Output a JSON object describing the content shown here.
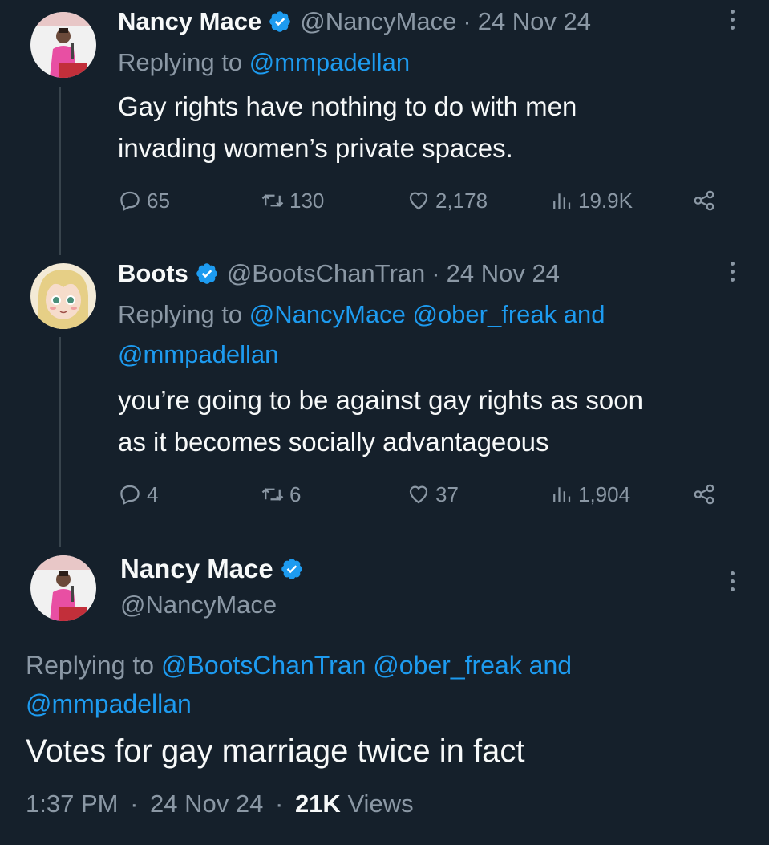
{
  "tweets": [
    {
      "name": "Nancy Mace",
      "handle": "@NancyMace",
      "date": "24 Nov 24",
      "replying_prefix": "Replying to ",
      "replying_line1": "@mmpadellan",
      "replying_line2": "",
      "text_line1": "Gay rights have nothing to do with men",
      "text_line2": "invading women’s private spaces.",
      "replies": "65",
      "retweets": "130",
      "likes": "2,178",
      "views": "19.9K"
    },
    {
      "name": "Boots",
      "handle": "@BootsChanTran",
      "date": "24 Nov 24",
      "replying_prefix": "Replying to ",
      "replying_line1": "@NancyMace @ober_freak and",
      "replying_line2": "@mmpadellan",
      "text_line1": "you’re going to be against gay rights as soon",
      "text_line2": "as it becomes socially advantageous",
      "replies": "4",
      "retweets": "6",
      "likes": "37",
      "views": "1,904"
    }
  ],
  "main_tweet": {
    "name": "Nancy Mace",
    "handle": "@NancyMace",
    "replying_prefix": "Replying to ",
    "replying_line1": "@BootsChanTran @ober_freak and",
    "replying_line2": "@mmpadellan",
    "text": "Votes for gay marriage twice in fact",
    "time": "1:37 PM",
    "date": "24 Nov 24",
    "views_count": "21K",
    "views_label": "Views"
  },
  "separator": "·",
  "colors": {
    "background": "#15202b",
    "text": "#f7f9f9",
    "muted": "#8b98a5",
    "link": "#1d9bf0",
    "thread_line": "#38444d"
  },
  "icons": [
    "verified-badge-icon",
    "more-options-icon",
    "reply-icon",
    "retweet-icon",
    "like-icon",
    "views-icon",
    "share-icon"
  ]
}
